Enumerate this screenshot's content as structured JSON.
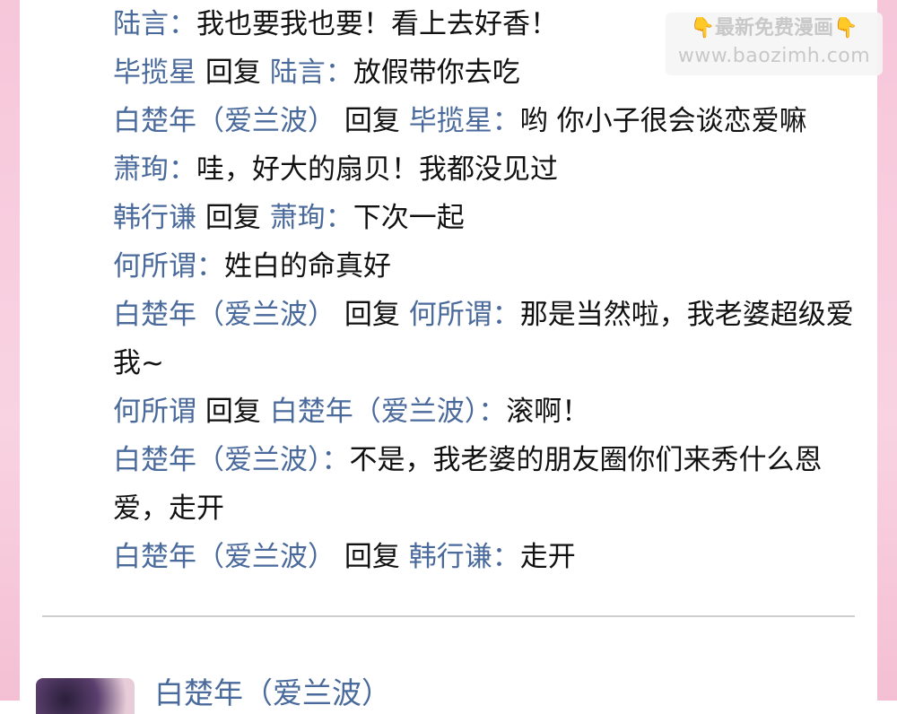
{
  "comments": [
    {
      "author": "陆言",
      "sep": "：",
      "text": "我也要我也要！看上去好香！"
    },
    {
      "author": "毕揽星",
      "reply_word": " 回复 ",
      "reply_to": "陆言",
      "sep": "：",
      "text": "放假带你去吃"
    },
    {
      "author": "白楚年（爱兰波）",
      "reply_word": " 回复 ",
      "reply_to": "毕揽星",
      "sep": "：",
      "text": "哟 你小子很会谈恋爱嘛"
    },
    {
      "author": "萧珣",
      "sep": "：",
      "text": "哇，好大的扇贝！我都没见过"
    },
    {
      "author": "韩行谦",
      "reply_word": " 回复 ",
      "reply_to": "萧珣",
      "sep": "：",
      "text": "下次一起"
    },
    {
      "author": "何所谓",
      "sep": "：",
      "text": "姓白的命真好"
    },
    {
      "author": "白楚年（爱兰波）",
      "reply_word": " 回复 ",
      "reply_to": "何所谓",
      "sep": "：",
      "text": "那是当然啦，我老婆超级爱我~"
    },
    {
      "author": "何所谓",
      "reply_word": " 回复 ",
      "reply_to": "白楚年（爱兰波）",
      "sep": "：",
      "text": "滚啊！"
    },
    {
      "author": "白楚年（爱兰波）",
      "sep": "：",
      "text": "不是，我老婆的朋友圈你们来秀什么恩爱，走开"
    },
    {
      "author": "白楚年（爱兰波）",
      "reply_word": " 回复 ",
      "reply_to": "韩行谦",
      "sep": "：",
      "text": "走开"
    }
  ],
  "next_post": {
    "author": "白楚年（爱兰波）"
  },
  "watermark": {
    "emoji": "👇",
    "line1": "最新免费漫画",
    "line2": "www.baozimh.com"
  },
  "colors": {
    "name": "#4a6a9c",
    "text": "#111111",
    "side": "#f6c6d9"
  }
}
